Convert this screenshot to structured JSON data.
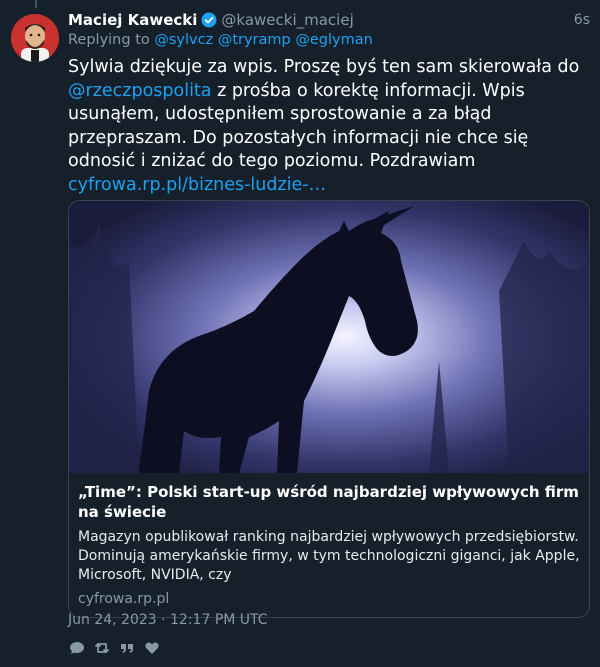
{
  "tweet": {
    "author_name": "Maciej Kawecki",
    "author_handle": "@kawecki_maciej",
    "time_ago": "6s",
    "replying_to_label": "Replying to",
    "replying_to": [
      "@sylvcz",
      "@tryramp",
      "@eglyman"
    ],
    "text_part1": "Sylwia dziękuje za wpis. Proszę byś ten sam skierowała do ",
    "mention": "@rzeczpospolita",
    "text_part2": " z prośba o korektę informacji. Wpis usunąłem, udostępniłem sprostowanie a za błąd przepraszam. Do pozostałych informacji nie chce się odnosić i zniżać do tego poziomu. Pozdrawiam ",
    "link_text": "cyfrowa.rp.pl/biznes-ludzie-…",
    "timestamp": "Jun 24, 2023 · 12:17 PM UTC"
  },
  "card": {
    "title": "„Time”: Polski start-up wśród najbardziej wpływowych firm na świecie",
    "description": "Magazyn opublikował ranking najbardziej wpływowych przedsiębiorstw. Dominują amerykańskie firmy, w tym technologiczni giganci, jak Apple, Microsoft, NVIDIA, czy",
    "domain": "cyfrowa.rp.pl"
  },
  "icons": {
    "verified": "verified-badge-icon",
    "reply": "comment-icon",
    "retweet": "retweet-icon",
    "quote": "quote-icon",
    "like": "heart-icon"
  },
  "colors": {
    "background": "#15202b",
    "link": "#1da1f2",
    "muted": "#8899a6",
    "border": "#38444d"
  }
}
